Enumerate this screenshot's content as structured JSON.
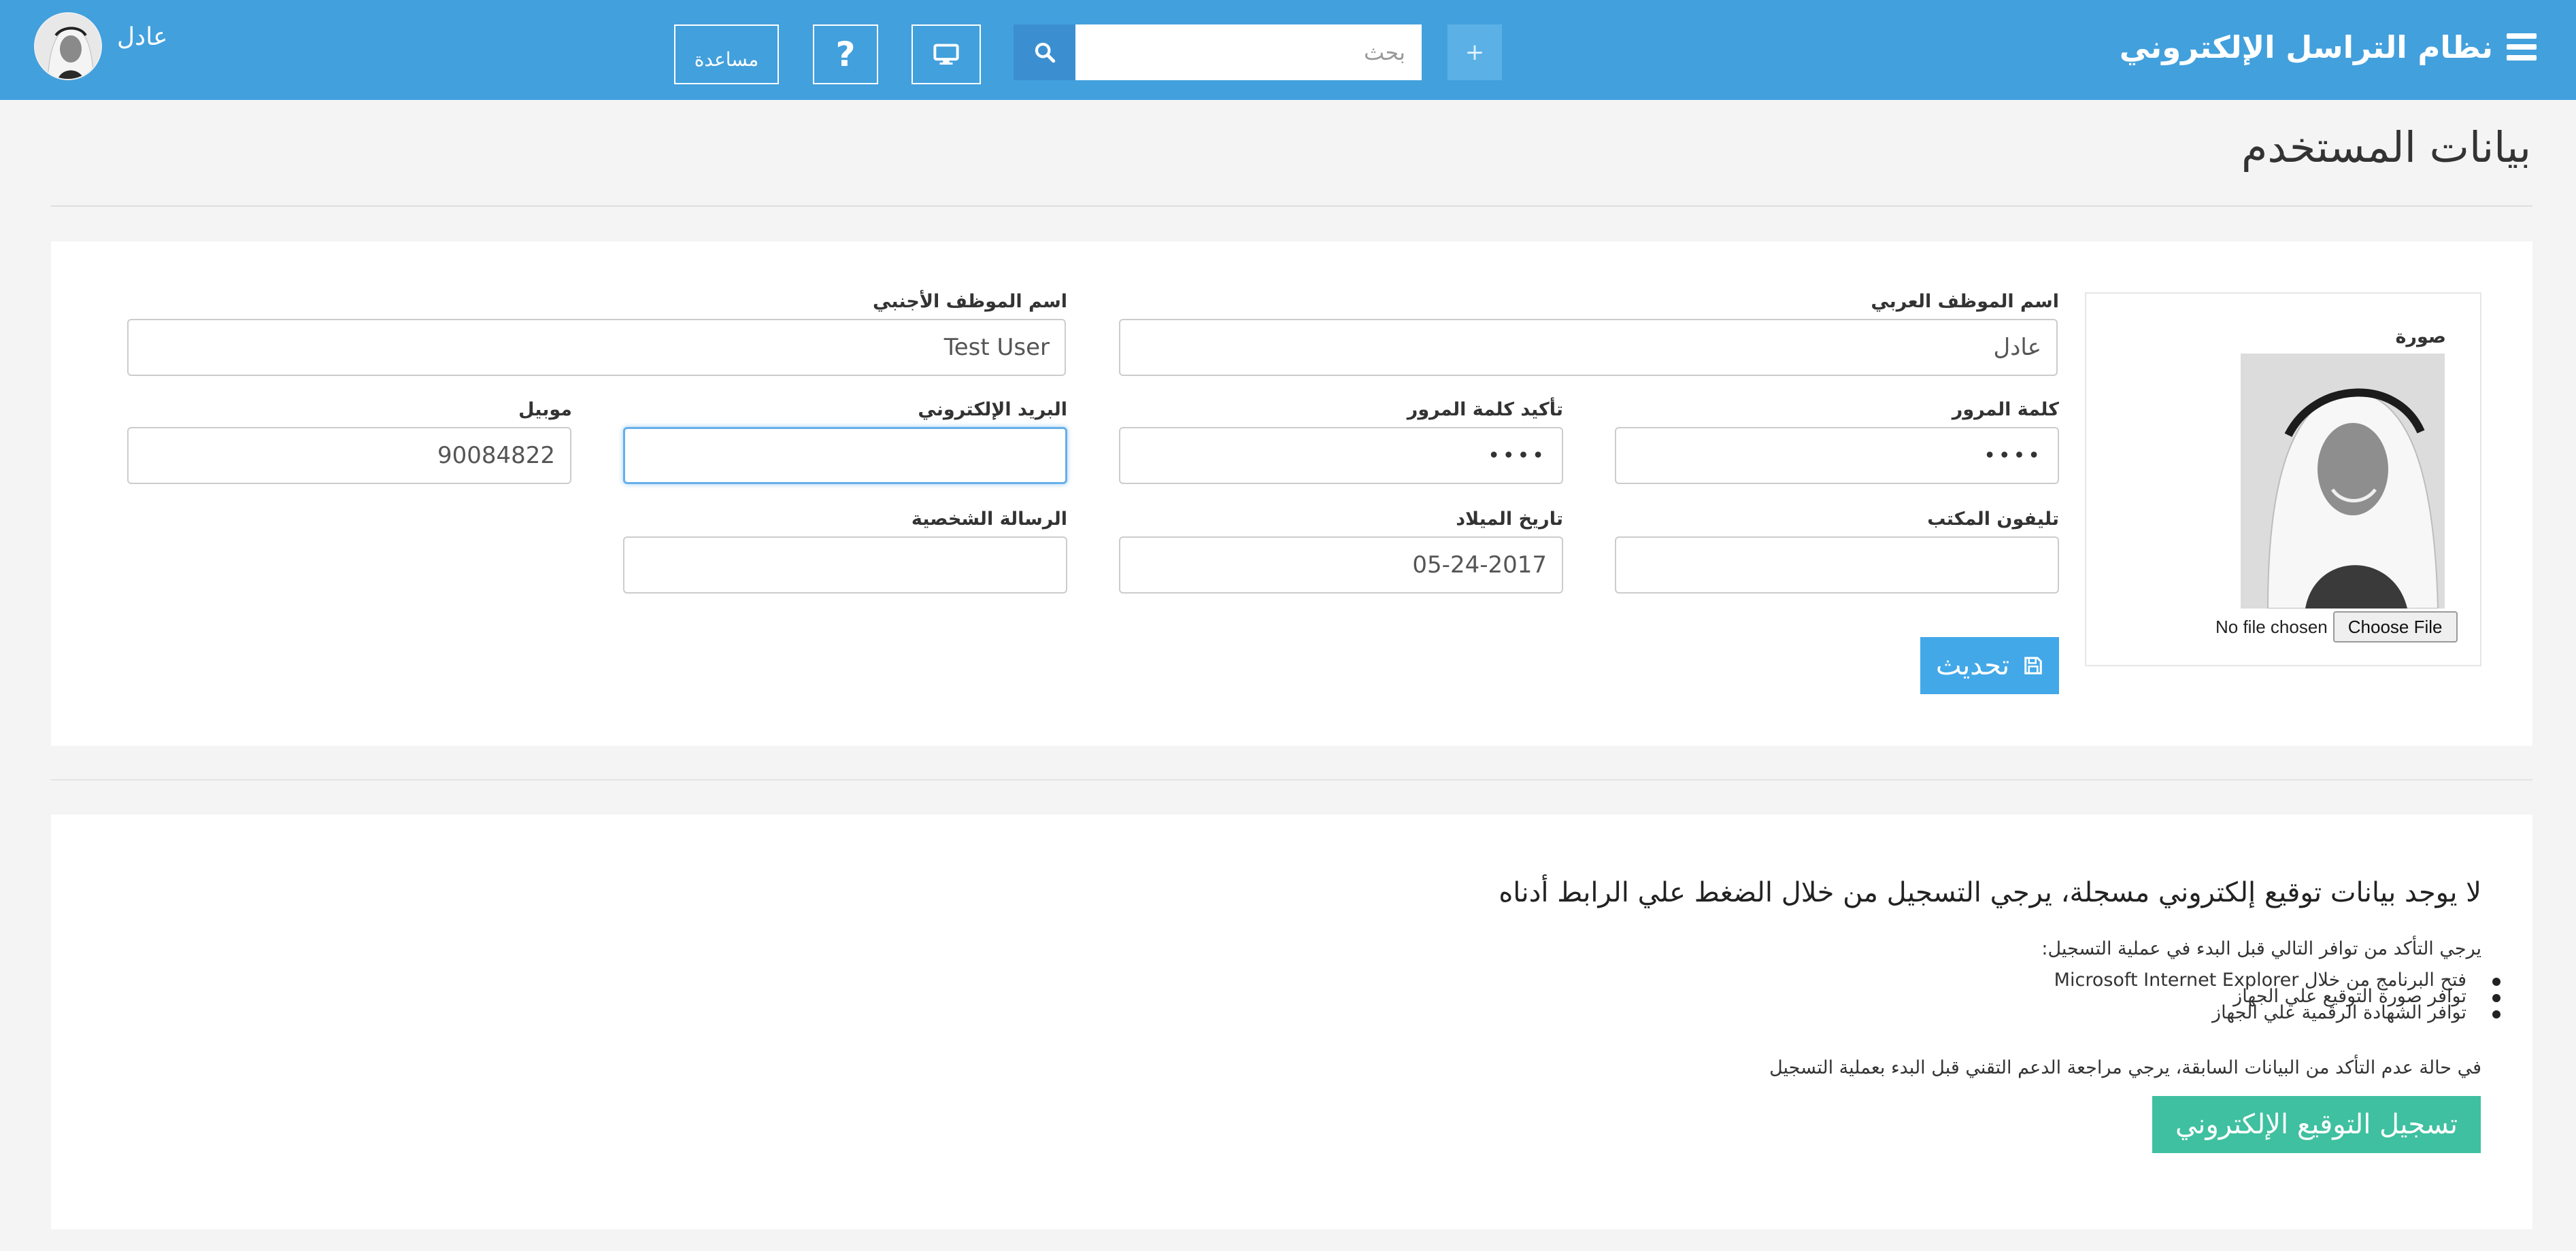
{
  "header": {
    "app_title": "نظام التراسل الإلكتروني",
    "add_label": "+",
    "search_placeholder": "بحث",
    "help_label": "مساعدة",
    "question_label": "?",
    "user_name": "عادل"
  },
  "page": {
    "title": "بيانات المستخدم"
  },
  "form": {
    "photo_label": "صورة",
    "file_status": "No file chosen",
    "file_button": "Choose File",
    "arabic_name": {
      "label": "اسم الموظف العربي",
      "value": "عادل"
    },
    "foreign_name": {
      "label": "اسم الموظف الأجنبي",
      "value": "Test User"
    },
    "password": {
      "label": "كلمة المرور",
      "value": "••••"
    },
    "confirm_password": {
      "label": "تأكيد كلمة المرور",
      "value": "••••"
    },
    "email": {
      "label": "البريد الإلكتروني",
      "value": ""
    },
    "mobile": {
      "label": "موبيل",
      "value": "90084822"
    },
    "office_phone": {
      "label": "تليفون المكتب",
      "value": ""
    },
    "birth_date": {
      "label": "تاريخ الميلاد",
      "value": "05-24-2017"
    },
    "personal_message": {
      "label": "الرسالة الشخصية",
      "value": ""
    },
    "update_button": "تحديث"
  },
  "signature": {
    "heading": "لا يوجد بيانات توقيع إلكتروني مسجلة، يرجي التسجيل من خلال الضغط علي الرابط أدناه",
    "intro": "يرجي التأكد من توافر التالي قبل البدء في عملية التسجيل:",
    "requirements": [
      "فتح البرنامج من خلال Microsoft Internet Explorer",
      "توافر صورة التوقيع علي الجهاز",
      "توافر الشهادة الرقمية علي الجهاز"
    ],
    "note": "في حالة عدم التأكد من البيانات السابقة، يرجي مراجعة الدعم التقني قبل البدء بعملية التسجيل",
    "register_button": "تسجيل التوقيع الإلكتروني"
  },
  "colors": {
    "header_bg": "#42a0dd",
    "primary_button": "#42a8e8",
    "success_button": "#3fc0a0",
    "page_bg": "#f4f4f4"
  },
  "icons": {
    "menu": "hamburger-icon",
    "search": "search-icon",
    "monitor": "monitor-icon",
    "save": "save-icon"
  }
}
